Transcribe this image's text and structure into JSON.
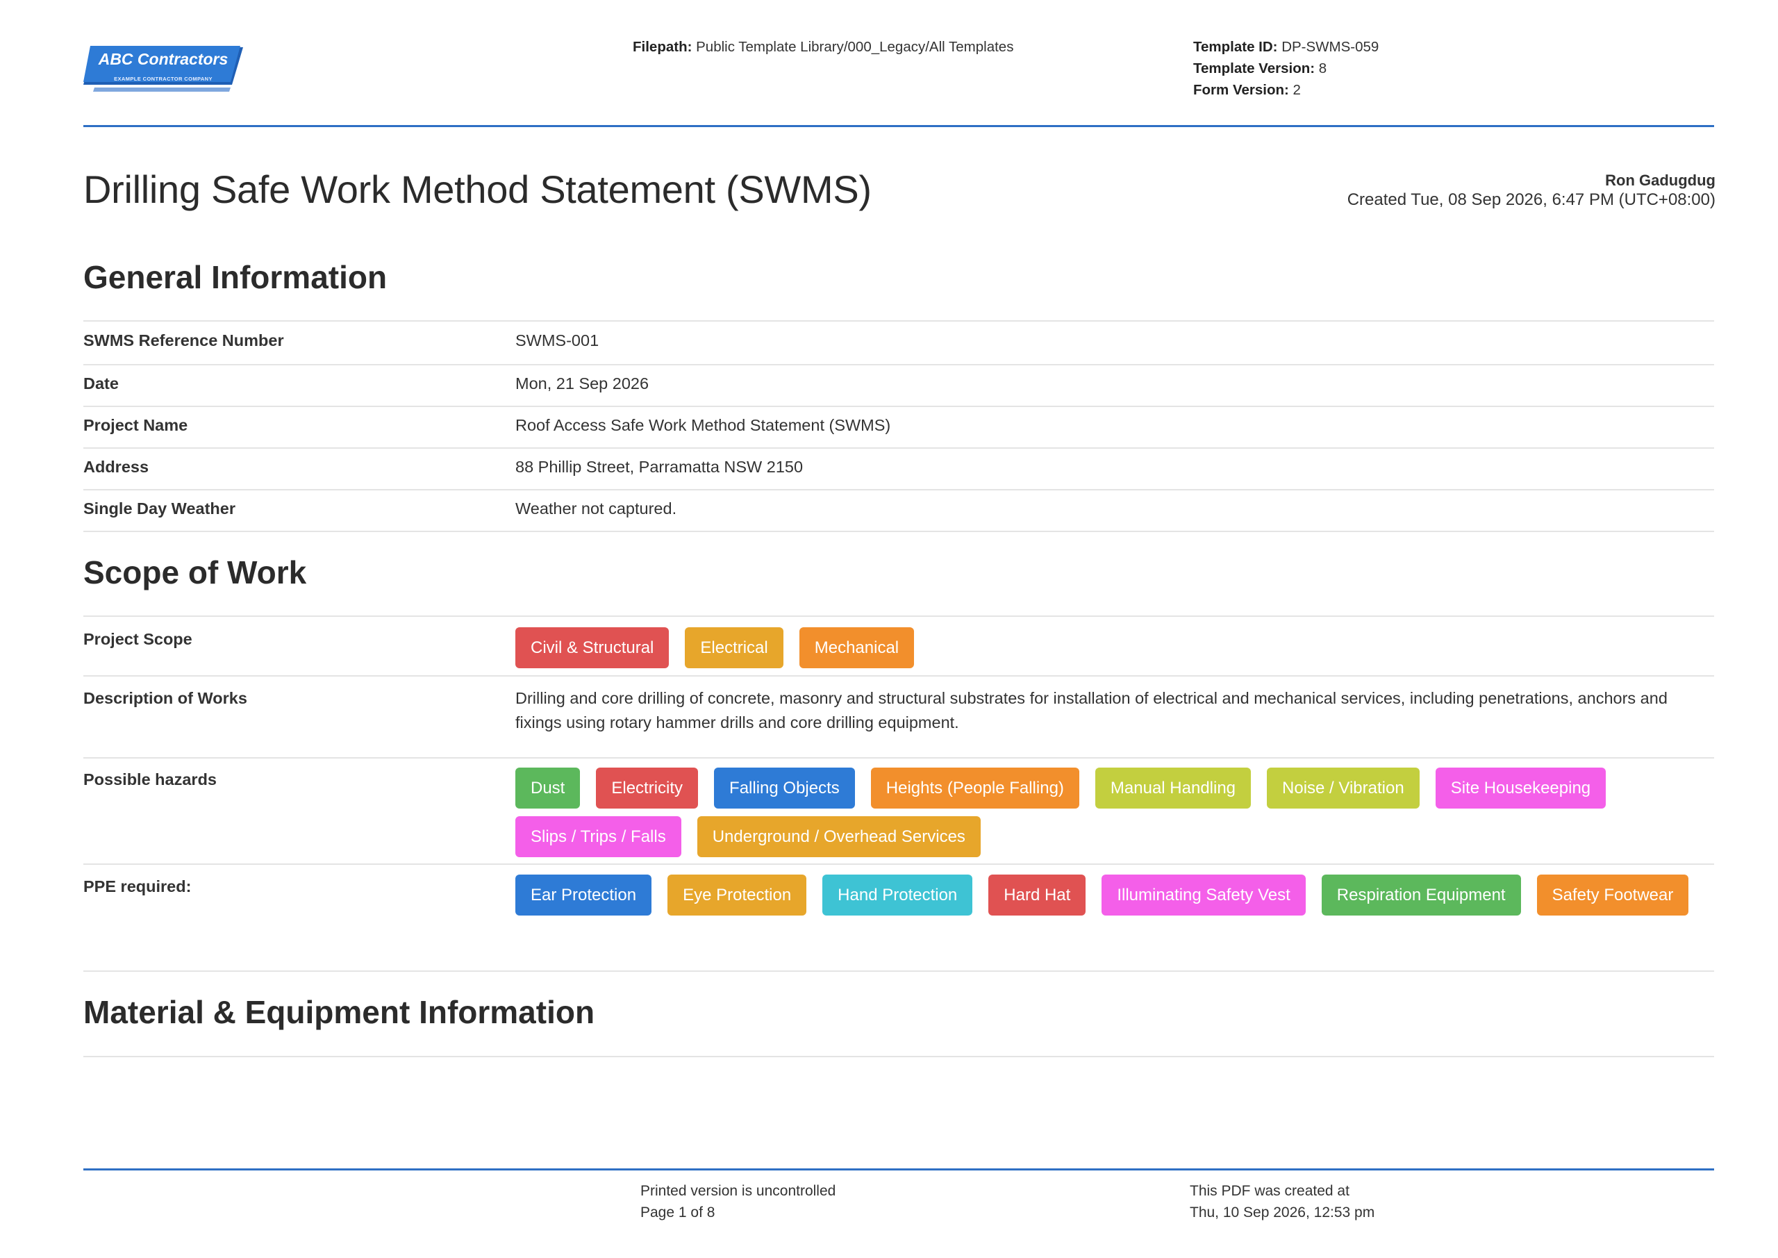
{
  "header": {
    "logo": {
      "title": "ABC Contractors",
      "subtitle": "EXAMPLE CONTRACTOR COMPANY"
    },
    "filepath_label": "Filepath:",
    "filepath_value": "Public Template Library/000_Legacy/All Templates",
    "template_id_label": "Template ID:",
    "template_id_value": "DP-SWMS-059",
    "template_version_label": "Template Version:",
    "template_version_value": "8",
    "form_version_label": "Form Version:",
    "form_version_value": "2",
    "accent_color": "#2e6fc4"
  },
  "document": {
    "title": "Drilling Safe Work Method Statement (SWMS)",
    "author": "Ron Gadugdug",
    "created": "Created Tue, 08 Sep 2026, 6:47 PM (UTC+08:00)"
  },
  "general": {
    "heading": "General Information",
    "rows": [
      {
        "label": "SWMS Reference Number",
        "value": "SWMS-001"
      },
      {
        "label": "Date",
        "value": "Mon, 21 Sep 2026"
      },
      {
        "label": "Project Name",
        "value": "Roof Access Safe Work Method Statement (SWMS)"
      },
      {
        "label": "Address",
        "value": "88 Phillip Street, Parramatta NSW 2150"
      },
      {
        "label": "Single Day Weather",
        "value": "Weather not captured."
      }
    ]
  },
  "scope": {
    "heading": "Scope of Work",
    "project_scope_label": "Project Scope",
    "project_scope": [
      {
        "label": "Civil & Structural",
        "color": "#e05252"
      },
      {
        "label": "Electrical",
        "color": "#e7a62b"
      },
      {
        "label": "Mechanical",
        "color": "#f28f2c"
      }
    ],
    "description_label": "Description of Works",
    "description": "Drilling and core drilling of concrete, masonry and structural substrates for installation of electrical and mechanical services, including penetrations, anchors and fixings using rotary hammer drills and core drilling equipment.",
    "hazards_label": "Possible hazards",
    "hazards": [
      {
        "label": "Dust",
        "color": "#5cb85c"
      },
      {
        "label": "Electricity",
        "color": "#e05252"
      },
      {
        "label": "Falling Objects",
        "color": "#2e7bd6"
      },
      {
        "label": "Heights (People Falling)",
        "color": "#f28f2c"
      },
      {
        "label": "Manual Handling",
        "color": "#c3cf3f"
      },
      {
        "label": "Noise / Vibration",
        "color": "#c3cf3f"
      },
      {
        "label": "Site Housekeeping",
        "color": "#f45fe9"
      },
      {
        "label": "Slips / Trips / Falls",
        "color": "#f45fe9"
      },
      {
        "label": "Underground / Overhead Services",
        "color": "#e7a62b"
      }
    ],
    "ppe_label": "PPE required:",
    "ppe": [
      {
        "label": "Ear Protection",
        "color": "#2e7bd6"
      },
      {
        "label": "Eye Protection",
        "color": "#e7a62b"
      },
      {
        "label": "Hand Protection",
        "color": "#3ec3d4"
      },
      {
        "label": "Hard Hat",
        "color": "#e05252"
      },
      {
        "label": "Illuminating Safety Vest",
        "color": "#f45fe9"
      },
      {
        "label": "Respiration Equipment",
        "color": "#5cb85c"
      },
      {
        "label": "Safety Footwear",
        "color": "#f28f2c"
      }
    ]
  },
  "materials": {
    "heading": "Material & Equipment Information"
  },
  "footer": {
    "uncontrolled": "Printed version is uncontrolled",
    "page": "Page 1 of 8",
    "created_label": "This PDF was created at",
    "created_value": "Thu, 10 Sep 2026, 12:53 pm"
  }
}
